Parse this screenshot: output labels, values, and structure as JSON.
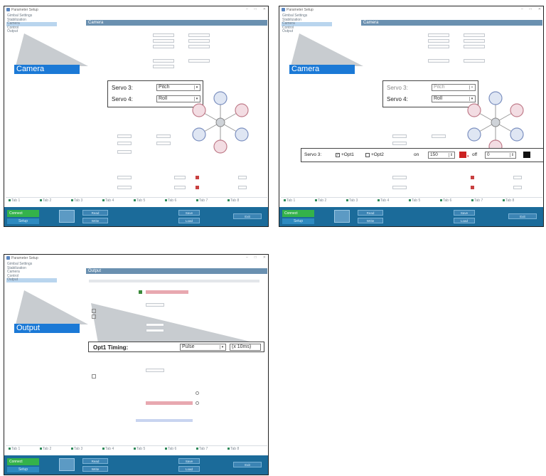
{
  "app": {
    "title": "Parameter Setup"
  },
  "windows": [
    {
      "id": "camera-1",
      "sidebar": [
        "Gimbal Settings",
        "Stabilization",
        "Camera",
        "Control",
        "Output"
      ],
      "selected": 2,
      "callout": "Camera",
      "header": "Camera",
      "panel": {
        "rows": [
          {
            "label": "Servo 3:",
            "value": "Pitch"
          },
          {
            "label": "Servo 4:",
            "value": "Roll"
          }
        ]
      }
    },
    {
      "id": "camera-2",
      "sidebar": [
        "Gimbal Settings",
        "Stabilization",
        "Camera",
        "Control",
        "Output"
      ],
      "selected": 2,
      "callout": "Camera",
      "header": "Camera",
      "panel": {
        "rows": [
          {
            "label": "Servo 3:",
            "value": "Pitch"
          },
          {
            "label": "Servo 4:",
            "value": "Roll"
          }
        ]
      },
      "servo_strip": {
        "label": "Servo 3:",
        "opt1": "+Opt1",
        "opt2": "+Opt2",
        "on": "on",
        "on_value": "150",
        "off": "off",
        "off_value": "0"
      }
    },
    {
      "id": "output",
      "sidebar": [
        "Gimbal Settings",
        "Stabilization",
        "Camera",
        "Control",
        "Output"
      ],
      "selected": 4,
      "callout": "Output",
      "header": "Output",
      "panel": {
        "rows": [
          {
            "label": "Opt1 Timing:",
            "value": "Pulse",
            "extra": "(x 10ms)"
          }
        ]
      }
    }
  ],
  "footer_tabs": [
    "Tab 1",
    "Tab 2",
    "Tab 3",
    "Tab 4",
    "Tab 5",
    "Tab 6",
    "Tab 7",
    "Tab 8"
  ],
  "bottom": {
    "connect": "Connect",
    "sub": "Setup",
    "read": "Read",
    "write": "Write",
    "save": "Save",
    "load": "Load",
    "exit": "Exit"
  },
  "colors": {
    "accent": "#1b79d6",
    "header": "#6a90b0",
    "bottombar": "#1b6b9a",
    "green": "#34b24a"
  }
}
